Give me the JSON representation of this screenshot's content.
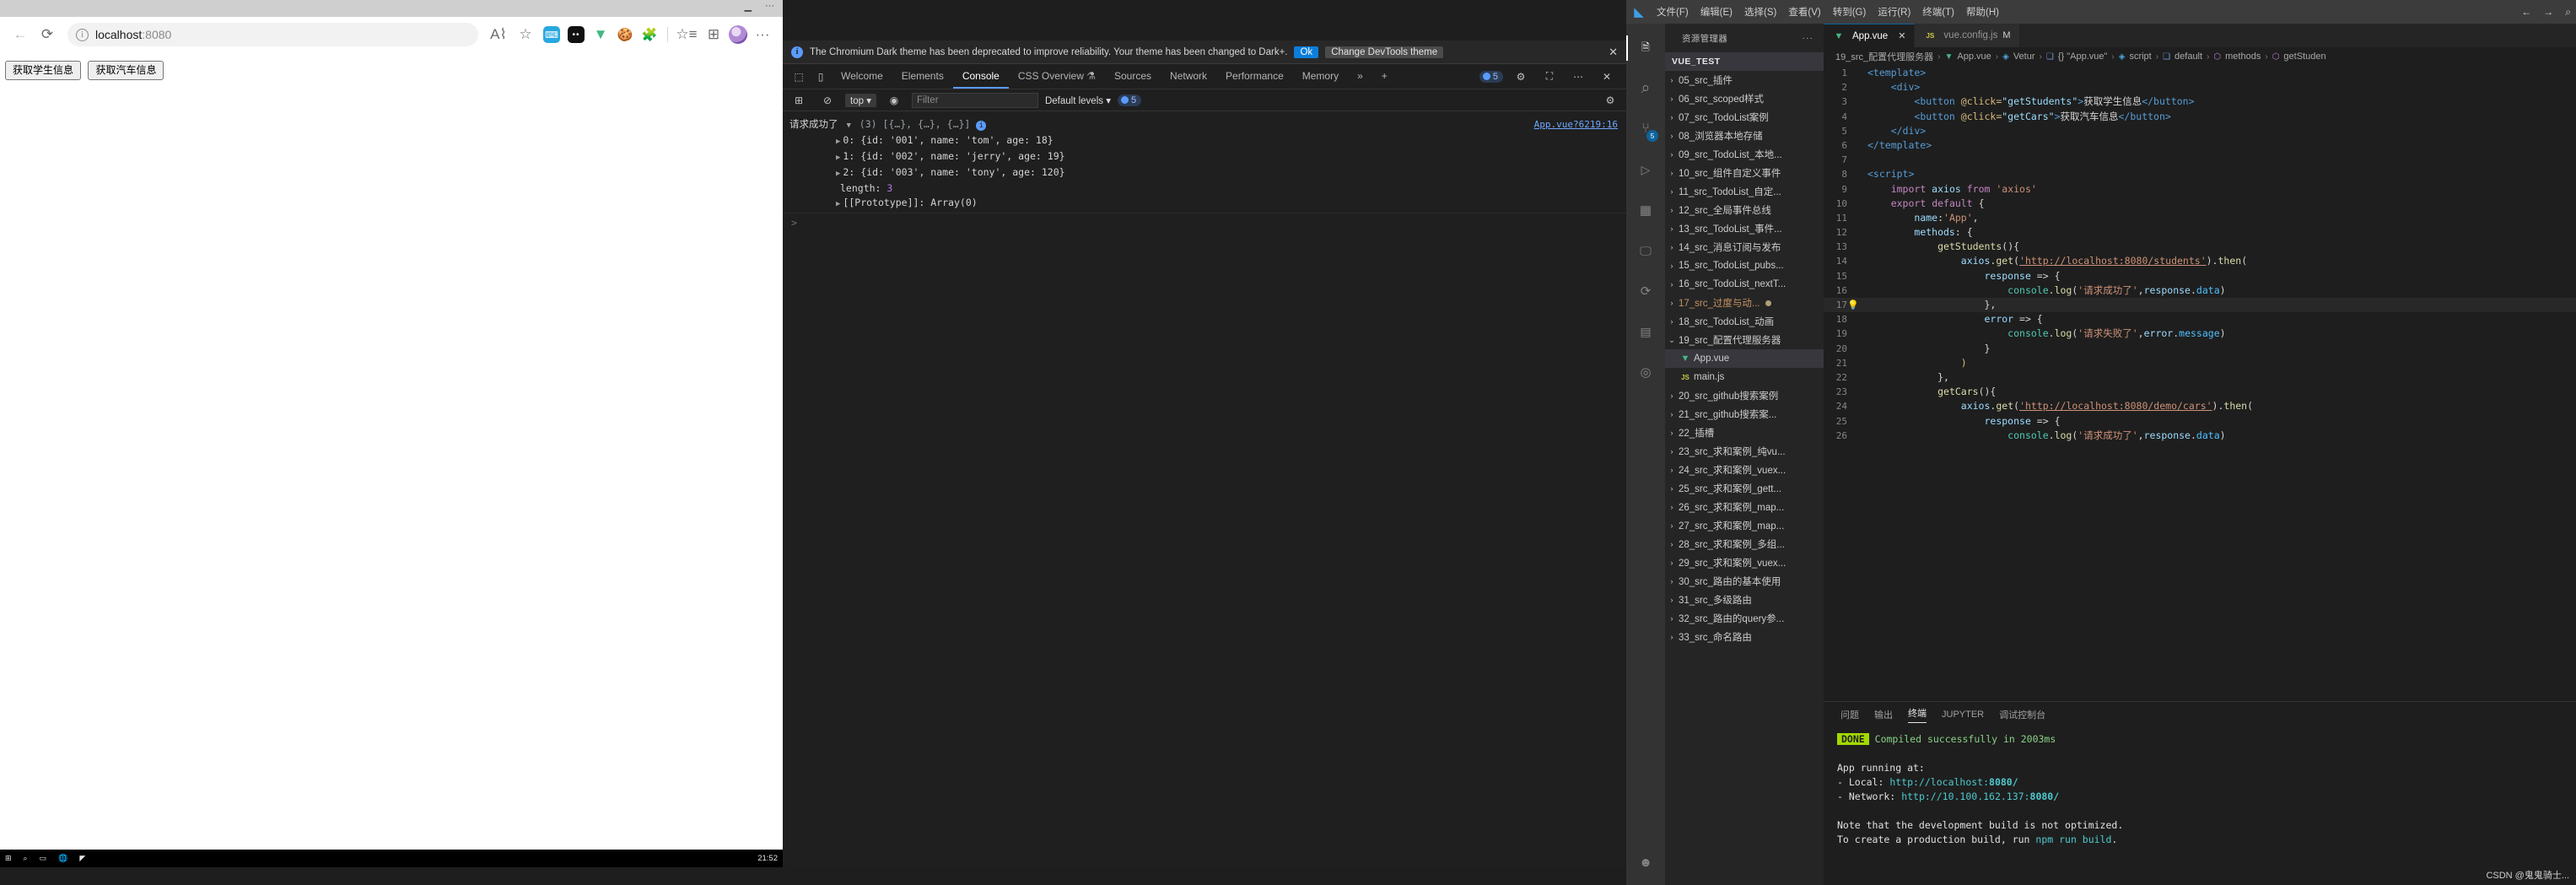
{
  "browser": {
    "url_host": "localhost",
    "url_port": ":8080",
    "back_icon": "back-arrow-icon",
    "reload_icon": "reload-icon",
    "info_icon": "info-icon",
    "read_aloud_icon": "read-aloud-icon",
    "favorite_icon": "add-favorite-icon",
    "collections_icon": "collections-icon",
    "settings_icon": "more-settings-icon",
    "extensions": [
      "dictionary-extension",
      "dark-reader-extension",
      "vue-devtools-extension",
      "cookie-extension",
      "puzzle-extension"
    ],
    "page_buttons": [
      {
        "label": "获取学生信息"
      },
      {
        "label": "获取汽车信息"
      }
    ]
  },
  "taskbar": {
    "clock": "21:52"
  },
  "devtools": {
    "banner": {
      "message": "The Chromium Dark theme has been deprecated to improve reliability. Your theme has been changed to Dark+.",
      "ok_label": "Ok",
      "change_label": "Change DevTools theme",
      "close_label": "✕"
    },
    "tabs": [
      {
        "label": "Welcome",
        "active": false
      },
      {
        "label": "Elements",
        "active": false
      },
      {
        "label": "Console",
        "active": true
      },
      {
        "label": "CSS Overview",
        "active": false
      },
      {
        "label": "Sources",
        "active": false
      },
      {
        "label": "Network",
        "active": false
      },
      {
        "label": "Performance",
        "active": false
      },
      {
        "label": "Memory",
        "active": false
      }
    ],
    "tabs_more": "»",
    "tabs_add": "+",
    "issue_count": "5",
    "settings_icon": "gear-icon",
    "dock_icon": "dock-side-icon",
    "more_icon": "more-options-icon",
    "close_icon": "close-icon",
    "filterbar": {
      "sidebar_icon": "console-sidebar-icon",
      "clear_icon": "clear-console-icon",
      "context": "top",
      "eye_icon": "live-expression-icon",
      "filter_placeholder": "Filter",
      "levels": "Default levels",
      "level_count": "5",
      "settings_icon": "console-settings-icon"
    },
    "console": {
      "message_label": "请求成功了",
      "summary": "(3) [{…}, {…}, {…}]",
      "source": "App.vue?6219:16",
      "rows": [
        {
          "index": "0:",
          "body": "{id: '001', name: 'tom', age: 18}"
        },
        {
          "index": "1:",
          "body": "{id: '002', name: 'jerry', age: 19}"
        },
        {
          "index": "2:",
          "body": "{id: '003', name: 'tony', age: 120}"
        }
      ],
      "length_label": "length:",
      "length_value": "3",
      "prototype": "[[Prototype]]: Array(0)",
      "prompt": ">"
    }
  },
  "vscode": {
    "titlebar": {
      "logo": "vscode-logo-icon",
      "menus": [
        "文件(F)",
        "编辑(E)",
        "选择(S)",
        "查看(V)",
        "转到(G)",
        "运行(R)",
        "终端(T)",
        "帮助(H)"
      ],
      "back_icon": "nav-back-icon",
      "forward_icon": "nav-forward-icon",
      "search_icon": "search-icon"
    },
    "activitybar": [
      {
        "name": "explorer",
        "glyph": "🗎",
        "active": true,
        "badge": ""
      },
      {
        "name": "search",
        "glyph": "⌕",
        "active": false,
        "badge": ""
      },
      {
        "name": "source-control",
        "glyph": "⑂",
        "active": false,
        "badge": "5"
      },
      {
        "name": "run-and-debug",
        "glyph": "▷",
        "active": false,
        "badge": ""
      },
      {
        "name": "extensions",
        "glyph": "▦",
        "active": false,
        "badge": ""
      },
      {
        "name": "remote-explorer",
        "glyph": "🖵",
        "active": false,
        "badge": ""
      },
      {
        "name": "test",
        "glyph": "⟳",
        "active": false,
        "badge": ""
      },
      {
        "name": "docker",
        "glyph": "▤",
        "active": false,
        "badge": ""
      },
      {
        "name": "help",
        "glyph": "◎",
        "active": false,
        "badge": ""
      }
    ],
    "activitybar_bottom": {
      "name": "account",
      "glyph": "☻"
    },
    "sidebar": {
      "title": "资源管理器",
      "more": "···",
      "root": "VUE_TEST",
      "tree": [
        {
          "label": "05_src_插件",
          "type": "folder",
          "open": false
        },
        {
          "label": "06_src_scoped样式",
          "type": "folder",
          "open": false
        },
        {
          "label": "07_src_TodoList案例",
          "type": "folder",
          "open": false
        },
        {
          "label": "08_浏览器本地存储",
          "type": "folder",
          "open": false
        },
        {
          "label": "09_src_TodoList_本地...",
          "type": "folder",
          "open": false
        },
        {
          "label": "10_src_组件自定义事件",
          "type": "folder",
          "open": false
        },
        {
          "label": "11_src_TodoList_自定...",
          "type": "folder",
          "open": false
        },
        {
          "label": "12_src_全局事件总线",
          "type": "folder",
          "open": false
        },
        {
          "label": "13_src_TodoList_事件...",
          "type": "folder",
          "open": false
        },
        {
          "label": "14_src_消息订阅与发布",
          "type": "folder",
          "open": false
        },
        {
          "label": "15_src_TodoList_pubs...",
          "type": "folder",
          "open": false
        },
        {
          "label": "16_src_TodoList_nextT...",
          "type": "folder",
          "open": false
        },
        {
          "label": "17_src_过度与动...",
          "type": "folder",
          "open": false,
          "modified": true
        },
        {
          "label": "18_src_TodoList_动画",
          "type": "folder",
          "open": false
        },
        {
          "label": "19_src_配置代理服务器",
          "type": "folder",
          "open": true
        },
        {
          "label": "App.vue",
          "type": "vue",
          "selected": true
        },
        {
          "label": "main.js",
          "type": "js"
        },
        {
          "label": "20_src_github搜索案例",
          "type": "folder",
          "open": false
        },
        {
          "label": "21_src_github搜索案...",
          "type": "folder",
          "open": false
        },
        {
          "label": "22_插槽",
          "type": "folder",
          "open": false
        },
        {
          "label": "23_src_求和案例_纯vu...",
          "type": "folder",
          "open": false
        },
        {
          "label": "24_src_求和案例_vuex...",
          "type": "folder",
          "open": false
        },
        {
          "label": "25_src_求和案例_gett...",
          "type": "folder",
          "open": false
        },
        {
          "label": "26_src_求和案例_map...",
          "type": "folder",
          "open": false
        },
        {
          "label": "27_src_求和案例_map...",
          "type": "folder",
          "open": false
        },
        {
          "label": "28_src_求和案例_多组...",
          "type": "folder",
          "open": false
        },
        {
          "label": "29_src_求和案例_vuex...",
          "type": "folder",
          "open": false
        },
        {
          "label": "30_src_路由的基本使用",
          "type": "folder",
          "open": false
        },
        {
          "label": "31_src_多级路由",
          "type": "folder",
          "open": false
        },
        {
          "label": "32_src_路由的query参...",
          "type": "folder",
          "open": false
        },
        {
          "label": "33_src_命名路由",
          "type": "folder",
          "open": false
        }
      ]
    },
    "tabs": [
      {
        "label": "App.vue",
        "icon": "vue-file-icon",
        "active": true,
        "close": "✕"
      },
      {
        "label": "vue.config.js",
        "icon": "js-file-icon",
        "active": false,
        "flag": "M"
      }
    ],
    "breadcrumb": [
      "19_src_配置代理服务器",
      "App.vue",
      "Vetur",
      "{} \"App.vue\"",
      "script",
      "default",
      "methods",
      "getStuden"
    ],
    "code_lines": [
      {
        "n": "1",
        "tokens": [
          {
            "t": "<template>",
            "c": "k-tag"
          }
        ]
      },
      {
        "n": "2",
        "tokens": [
          {
            "t": "    <div>",
            "c": "k-tag"
          }
        ]
      },
      {
        "n": "3",
        "tokens": [
          {
            "t": "        ",
            "c": "k-txt"
          },
          {
            "t": "<button ",
            "c": "k-tag"
          },
          {
            "t": "@click=",
            "c": "k-yellow"
          },
          {
            "t": "\"getStudents\"",
            "c": "k-attr"
          },
          {
            "t": ">",
            "c": "k-tag"
          },
          {
            "t": "获取学生信息",
            "c": "k-txt"
          },
          {
            "t": "</button>",
            "c": "k-tag"
          }
        ]
      },
      {
        "n": "4",
        "tokens": [
          {
            "t": "        ",
            "c": "k-txt"
          },
          {
            "t": "<button ",
            "c": "k-tag"
          },
          {
            "t": "@click=",
            "c": "k-yellow"
          },
          {
            "t": "\"getCars\"",
            "c": "k-attr"
          },
          {
            "t": ">",
            "c": "k-tag"
          },
          {
            "t": "获取汽车信息",
            "c": "k-txt"
          },
          {
            "t": "</button>",
            "c": "k-tag"
          }
        ]
      },
      {
        "n": "5",
        "tokens": [
          {
            "t": "    </div>",
            "c": "k-tag"
          }
        ]
      },
      {
        "n": "6",
        "tokens": [
          {
            "t": "</template>",
            "c": "k-tag"
          }
        ]
      },
      {
        "n": "7",
        "tokens": [
          {
            "t": "",
            "c": "k-txt"
          }
        ]
      },
      {
        "n": "8",
        "tokens": [
          {
            "t": "<script>",
            "c": "k-tag"
          }
        ]
      },
      {
        "n": "9",
        "tokens": [
          {
            "t": "    ",
            "c": "k-txt"
          },
          {
            "t": "import",
            "c": "k-key"
          },
          {
            "t": " axios ",
            "c": "k-var"
          },
          {
            "t": "from",
            "c": "k-key"
          },
          {
            "t": " ",
            "c": "k-txt"
          },
          {
            "t": "'axios'",
            "c": "k-str"
          }
        ]
      },
      {
        "n": "10",
        "tokens": [
          {
            "t": "    ",
            "c": "k-txt"
          },
          {
            "t": "export",
            "c": "k-key"
          },
          {
            "t": " ",
            "c": "k-txt"
          },
          {
            "t": "default",
            "c": "k-key"
          },
          {
            "t": " {",
            "c": "k-punc"
          }
        ]
      },
      {
        "n": "11",
        "tokens": [
          {
            "t": "        ",
            "c": "k-txt"
          },
          {
            "t": "name",
            "c": "k-var"
          },
          {
            "t": ":",
            "c": "k-punc"
          },
          {
            "t": "'App'",
            "c": "k-str"
          },
          {
            "t": ",",
            "c": "k-punc"
          }
        ]
      },
      {
        "n": "12",
        "tokens": [
          {
            "t": "        ",
            "c": "k-txt"
          },
          {
            "t": "methods",
            "c": "k-var"
          },
          {
            "t": ": {",
            "c": "k-punc"
          }
        ]
      },
      {
        "n": "13",
        "tokens": [
          {
            "t": "            ",
            "c": "k-txt"
          },
          {
            "t": "getStudents",
            "c": "k-fn"
          },
          {
            "t": "(){",
            "c": "k-punc"
          }
        ]
      },
      {
        "n": "14",
        "tokens": [
          {
            "t": "                ",
            "c": "k-txt"
          },
          {
            "t": "axios",
            "c": "k-var"
          },
          {
            "t": ".",
            "c": "k-punc"
          },
          {
            "t": "get",
            "c": "k-fn"
          },
          {
            "t": "(",
            "c": "k-punc"
          },
          {
            "t": "'http://localhost:8080/students'",
            "c": "k-link"
          },
          {
            "t": ").",
            "c": "k-punc"
          },
          {
            "t": "then",
            "c": "k-fn"
          },
          {
            "t": "(",
            "c": "k-punc"
          }
        ]
      },
      {
        "n": "15",
        "tokens": [
          {
            "t": "                    ",
            "c": "k-txt"
          },
          {
            "t": "response",
            "c": "k-var"
          },
          {
            "t": " => {",
            "c": "k-punc"
          }
        ]
      },
      {
        "n": "16",
        "tokens": [
          {
            "t": "                        ",
            "c": "k-txt"
          },
          {
            "t": "console",
            "c": "k-prop"
          },
          {
            "t": ".",
            "c": "k-punc"
          },
          {
            "t": "log",
            "c": "k-fn"
          },
          {
            "t": "(",
            "c": "k-punc"
          },
          {
            "t": "'请求成功了'",
            "c": "k-str"
          },
          {
            "t": ",",
            "c": "k-punc"
          },
          {
            "t": "response",
            "c": "k-var"
          },
          {
            "t": ".",
            "c": "k-punc"
          },
          {
            "t": "data",
            "c": "k-blue2"
          },
          {
            "t": ")",
            "c": "k-punc"
          }
        ]
      },
      {
        "n": "17",
        "hl": true,
        "bulb": true,
        "tokens": [
          {
            "t": "                    },",
            "c": "k-punc"
          }
        ]
      },
      {
        "n": "18",
        "tokens": [
          {
            "t": "                    ",
            "c": "k-txt"
          },
          {
            "t": "error",
            "c": "k-var"
          },
          {
            "t": " => {",
            "c": "k-punc"
          }
        ]
      },
      {
        "n": "19",
        "tokens": [
          {
            "t": "                        ",
            "c": "k-txt"
          },
          {
            "t": "console",
            "c": "k-prop"
          },
          {
            "t": ".",
            "c": "k-punc"
          },
          {
            "t": "log",
            "c": "k-fn"
          },
          {
            "t": "(",
            "c": "k-punc"
          },
          {
            "t": "'请求失败了'",
            "c": "k-str"
          },
          {
            "t": ",",
            "c": "k-punc"
          },
          {
            "t": "error",
            "c": "k-var"
          },
          {
            "t": ".",
            "c": "k-punc"
          },
          {
            "t": "message",
            "c": "k-blue2"
          },
          {
            "t": ")",
            "c": "k-punc"
          }
        ]
      },
      {
        "n": "20",
        "tokens": [
          {
            "t": "                    }",
            "c": "k-punc"
          }
        ]
      },
      {
        "n": "21",
        "tokens": [
          {
            "t": "                )",
            "c": "k-yellow"
          }
        ]
      },
      {
        "n": "22",
        "tokens": [
          {
            "t": "            },",
            "c": "k-punc"
          }
        ]
      },
      {
        "n": "23",
        "tokens": [
          {
            "t": "            ",
            "c": "k-txt"
          },
          {
            "t": "getCars",
            "c": "k-fn"
          },
          {
            "t": "(){",
            "c": "k-punc"
          }
        ]
      },
      {
        "n": "24",
        "tokens": [
          {
            "t": "                ",
            "c": "k-txt"
          },
          {
            "t": "axios",
            "c": "k-var"
          },
          {
            "t": ".",
            "c": "k-punc"
          },
          {
            "t": "get",
            "c": "k-fn"
          },
          {
            "t": "(",
            "c": "k-punc"
          },
          {
            "t": "'http://localhost:8080/demo/cars'",
            "c": "k-link"
          },
          {
            "t": ").",
            "c": "k-punc"
          },
          {
            "t": "then",
            "c": "k-fn"
          },
          {
            "t": "(",
            "c": "k-punc"
          }
        ]
      },
      {
        "n": "25",
        "tokens": [
          {
            "t": "                    ",
            "c": "k-txt"
          },
          {
            "t": "response",
            "c": "k-var"
          },
          {
            "t": " => {",
            "c": "k-punc"
          }
        ]
      },
      {
        "n": "26",
        "tokens": [
          {
            "t": "                        ",
            "c": "k-txt"
          },
          {
            "t": "console",
            "c": "k-prop"
          },
          {
            "t": ".",
            "c": "k-punc"
          },
          {
            "t": "log",
            "c": "k-fn"
          },
          {
            "t": "(",
            "c": "k-punc"
          },
          {
            "t": "'请求成功了'",
            "c": "k-str"
          },
          {
            "t": ",",
            "c": "k-punc"
          },
          {
            "t": "response",
            "c": "k-var"
          },
          {
            "t": ".",
            "c": "k-punc"
          },
          {
            "t": "data",
            "c": "k-blue2"
          },
          {
            "t": ")",
            "c": "k-punc"
          }
        ]
      }
    ],
    "panel": {
      "tabs": [
        {
          "label": "问题",
          "active": false
        },
        {
          "label": "输出",
          "active": false
        },
        {
          "label": "终端",
          "active": true
        },
        {
          "label": "JUPYTER",
          "active": false
        },
        {
          "label": "调试控制台",
          "active": false
        }
      ],
      "terminal": {
        "done_badge": "DONE",
        "compiled": "Compiled successfully in 2003ms",
        "running_at": "App running at:",
        "local_label": "- Local:",
        "local_url_prefix": "http://localhost:",
        "local_port": "8080/",
        "network_label": "- Network:",
        "network_url_prefix": "http://10.100.162.137:",
        "network_port": "8080/",
        "note1": "Note that the development build is not optimized.",
        "note2_pre": "To create a production build, run ",
        "note2_cmd": "npm run build",
        "note2_post": "."
      }
    }
  },
  "watermark": "CSDN @鬼鬼骑士..."
}
